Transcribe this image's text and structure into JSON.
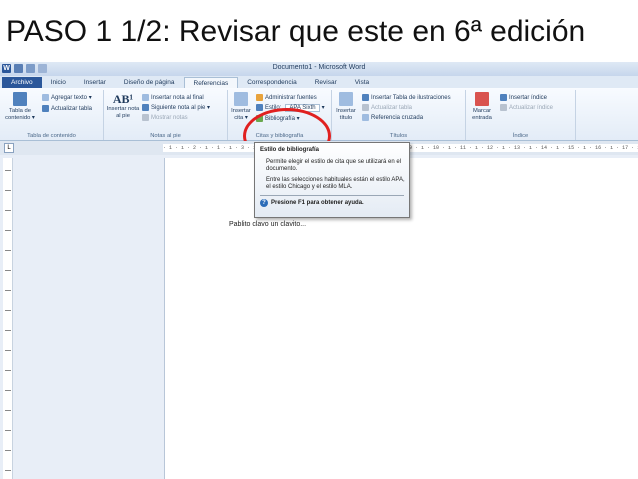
{
  "slide": {
    "title": "PASO 1 1/2: Revisar que este en 6ª edición"
  },
  "window": {
    "title": "Documento1 - Microsoft Word",
    "logo_letter": "W"
  },
  "tabs": [
    {
      "label": "Archivo"
    },
    {
      "label": "Inicio"
    },
    {
      "label": "Insertar"
    },
    {
      "label": "Diseño de página"
    },
    {
      "label": "Referencias"
    },
    {
      "label": "Correspondencia"
    },
    {
      "label": "Revisar"
    },
    {
      "label": "Vista"
    }
  ],
  "active_tab": "Referencias",
  "ribbon": {
    "toc_group": {
      "label": "Tabla de contenido",
      "big_button": "Tabla de contenido ▾",
      "add_text": "Agregar texto ▾",
      "update_table": "Actualizar tabla"
    },
    "footnotes_group": {
      "label": "Notas al pie",
      "big_button": "Insertar nota al pie",
      "ab_glyph": "AB¹",
      "insert_endnote": "Insertar nota al final",
      "next_footnote": "Siguiente nota al pie ▾",
      "show_notes": "Mostrar notas"
    },
    "citations_group": {
      "label": "Citas y bibliografía",
      "big_button": "Insertar cita ▾",
      "manage_sources": "Administrar fuentes",
      "style_label": "Estilo:",
      "style_value": "APA Sixth",
      "bibliography": "Bibliografía ▾"
    },
    "captions_group": {
      "label": "Títulos",
      "big_button": "Insertar título",
      "insert_table_figures": "Insertar Tabla de ilustraciones",
      "update_table": "Actualizar tabla",
      "cross_reference": "Referencia cruzada"
    },
    "index_group": {
      "label": "Índice",
      "big_button": "Marcar entrada",
      "insert_index": "Insertar índice",
      "update_index": "Actualizar índice"
    }
  },
  "tooltip": {
    "title": "Estilo de bibliografía",
    "description": "Permite elegir el estilo de cita que se utilizará en el documento.",
    "description2": "Entre las selecciones habituales están el estilo APA, el estilo Chicago y el estilo MLA.",
    "help": "Presione F1 para obtener ayuda."
  },
  "ruler": {
    "text": "· 1 · ı · 2 · ı · 1 · ı · 3 · ı · 1 · ı · 4 · ı · 5 · ı · 6 · ı · 7 · ı · 8 · ı · 9 · ı · 10 · ı · 11 · ı · 12 · ı · 13 · ı · 14 · ı · 15 · ı · 16 · ı · 17 · ı · 18"
  },
  "document": {
    "body_text": "Pablito clavo un clavito..."
  },
  "colors": {
    "highlight": "#e02020",
    "file_tab": "#2b579a",
    "ribbon_text": "#1e395b"
  }
}
